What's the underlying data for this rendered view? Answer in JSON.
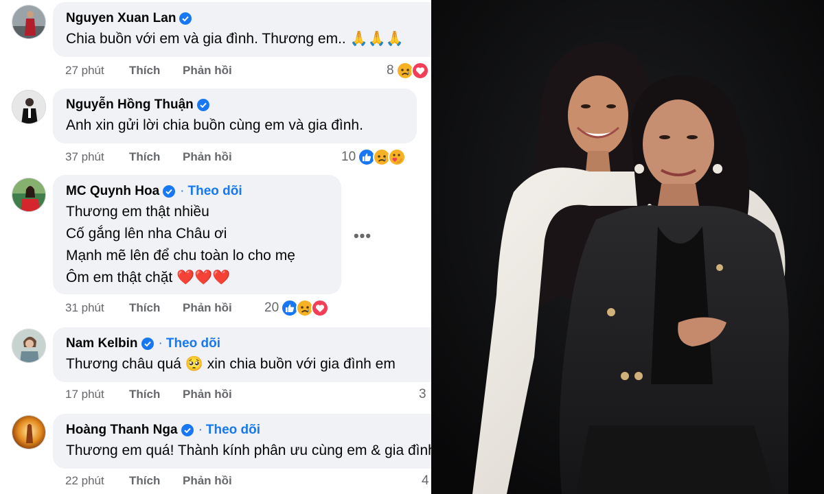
{
  "comments": [
    {
      "name": "Nguyen Xuan Lan",
      "verified": true,
      "follow": "",
      "lines": [
        "Chia buồn với em và gia đình. Thương em.. 🙏🙏🙏"
      ],
      "time": "27 phút",
      "like": "Thích",
      "reply": "Phản hồi",
      "reaction_count": "8",
      "reaction_icons": [
        "sad-icon",
        "love-icon"
      ]
    },
    {
      "name": "Nguyễn Hồng Thuận",
      "verified": true,
      "follow": "",
      "lines": [
        "Anh xin gửi lời chia buồn cùng em và gia đình."
      ],
      "time": "37 phút",
      "like": "Thích",
      "reply": "Phản hồi",
      "reaction_count": "10",
      "reaction_icons": [
        "like-icon",
        "sad-icon",
        "care-icon"
      ]
    },
    {
      "name": "MC Quynh Hoa",
      "verified": true,
      "follow": "Theo dõi",
      "lines": [
        "Thương em thật nhiều",
        "Cố gắng lên nha Châu ơi",
        "Mạnh mẽ lên để chu toàn lo cho mẹ",
        "Ôm em thật chặt ❤️❤️❤️"
      ],
      "time": "31 phút",
      "like": "Thích",
      "reply": "Phản hồi",
      "reaction_count": "20",
      "reaction_icons": [
        "like-icon",
        "sad-icon",
        "love-icon"
      ]
    },
    {
      "name": "Nam Kelbin",
      "verified": true,
      "follow": "Theo dõi",
      "lines": [
        "Thương châu quá 🥺 xin chia buồn với gia đình em"
      ],
      "time": "17 phút",
      "like": "Thích",
      "reply": "Phản hồi",
      "reaction_count": "3",
      "reaction_icons": []
    },
    {
      "name": "Hoàng Thanh Nga",
      "verified": true,
      "follow": "Theo dõi",
      "lines": [
        "Thương em quá! Thành kính phân ưu cùng em & gia đình"
      ],
      "time": "22 phút",
      "like": "Thích",
      "reply": "Phản hồi",
      "reaction_count": "4",
      "reaction_icons": []
    }
  ],
  "more_options": "•••",
  "photo": {
    "description_icon": "portrait-photo",
    "background_color": "#0d0d0e"
  },
  "colors": {
    "link_blue": "#1877f2",
    "bubble_bg": "#f0f2f5",
    "meta_gray": "#65676b"
  }
}
